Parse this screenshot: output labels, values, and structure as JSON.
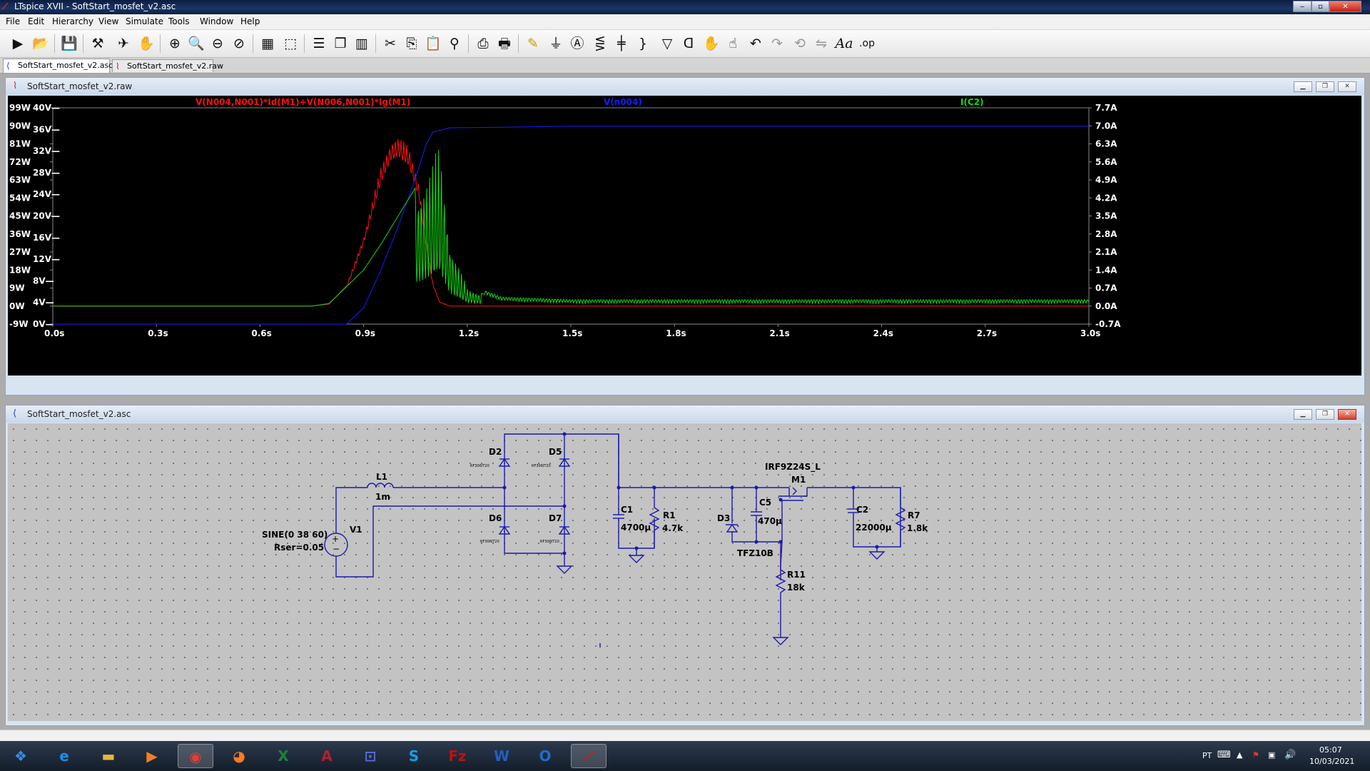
{
  "window": {
    "title": "LTspice XVII - SoftStart_mosfet_v2.asc",
    "minimize": "‒",
    "restore": "▫",
    "close": "✕"
  },
  "menu": [
    "File",
    "Edit",
    "Hierarchy",
    "View",
    "Simulate",
    "Tools",
    "Window",
    "Help"
  ],
  "toolbar_icons": [
    "run-icon",
    "open-icon",
    "save-icon",
    "control-panel-icon",
    "halt-icon",
    "pan-icon",
    "zoom-in-icon",
    "zoom-area-icon",
    "zoom-out-icon",
    "zoom-fit-icon",
    "autorange-icon",
    "zoom-cancel-icon",
    "tile-horizontal-icon",
    "cascade-icon",
    "tile-vertical-icon",
    "cut-icon",
    "copy-icon",
    "paste-icon",
    "find-icon",
    "print-icon",
    "print-preview-icon",
    "draw-wire-icon",
    "ground-icon",
    "label-net-icon",
    "resistor-icon",
    "capacitor-icon",
    "inductor-icon",
    "diode-icon",
    "component-icon",
    "move-icon",
    "drag-icon",
    "undo-icon",
    "redo-icon",
    "rotate-icon",
    "mirror-icon",
    "text-icon",
    "spice-directive-icon"
  ],
  "tabs": [
    {
      "label": "SoftStart_mosfet_v2.asc",
      "icon": "schematic-icon",
      "active": true
    },
    {
      "label": "SoftStart_mosfet_v2.raw",
      "icon": "waveform-icon",
      "active": false
    }
  ],
  "plot_window": {
    "title": "SoftStart_mosfet_v2.raw"
  },
  "schematic_window": {
    "title": "SoftStart_mosfet_v2.asc"
  },
  "chart_data": {
    "type": "line",
    "xlabel": "",
    "x_ticks": [
      "0.0s",
      "0.3s",
      "0.6s",
      "0.9s",
      "1.2s",
      "1.5s",
      "1.8s",
      "2.1s",
      "2.4s",
      "2.7s",
      "3.0s"
    ],
    "xlim": [
      0,
      3.0
    ],
    "left_axis_1": {
      "unit": "W",
      "ticks": [
        "99W",
        "90W",
        "81W",
        "72W",
        "63W",
        "54W",
        "45W",
        "36W",
        "27W",
        "18W",
        "9W",
        "0W",
        "-9W"
      ],
      "range": [
        -9,
        99
      ]
    },
    "left_axis_2": {
      "unit": "V",
      "ticks": [
        "40V",
        "36V",
        "32V",
        "28V",
        "24V",
        "20V",
        "16V",
        "12V",
        "8V",
        "4V",
        "0V"
      ],
      "range": [
        0,
        40
      ]
    },
    "right_axis": {
      "unit": "A",
      "ticks": [
        "7.7A",
        "7.0A",
        "6.3A",
        "5.6A",
        "4.9A",
        "4.2A",
        "3.5A",
        "2.8A",
        "2.1A",
        "1.4A",
        "0.7A",
        "0.0A",
        "-0.7A"
      ],
      "range": [
        -0.7,
        7.7
      ]
    },
    "grid": false,
    "series": [
      {
        "name": "V(N004,N001)*Id(M1)+V(N006,N001)*Ig(M1)",
        "color": "#ff1010",
        "axis": "W",
        "points": [
          [
            0,
            0
          ],
          [
            0.75,
            0
          ],
          [
            0.8,
            1
          ],
          [
            0.85,
            10
          ],
          [
            0.9,
            35
          ],
          [
            0.95,
            70
          ],
          [
            0.98,
            83
          ],
          [
            1.0,
            85
          ],
          [
            1.03,
            80
          ],
          [
            1.06,
            62
          ],
          [
            1.08,
            35
          ],
          [
            1.1,
            12
          ],
          [
            1.12,
            2
          ],
          [
            1.15,
            0
          ],
          [
            1.5,
            0
          ],
          [
            3.0,
            0
          ]
        ]
      },
      {
        "name": "V(n004)",
        "color": "#1a1aff",
        "axis": "V",
        "points": [
          [
            0,
            0
          ],
          [
            0.85,
            0
          ],
          [
            0.9,
            3
          ],
          [
            0.95,
            10
          ],
          [
            1.0,
            18
          ],
          [
            1.05,
            27
          ],
          [
            1.08,
            33
          ],
          [
            1.1,
            35.5
          ],
          [
            1.15,
            36.3
          ],
          [
            1.3,
            36.4
          ],
          [
            1.5,
            36.6
          ],
          [
            3.0,
            36.6
          ]
        ]
      },
      {
        "name": "I(C2)",
        "color": "#10dd10",
        "axis": "A",
        "points": [
          [
            0,
            0
          ],
          [
            0.75,
            0
          ],
          [
            0.8,
            0.1
          ],
          [
            0.9,
            1.4
          ],
          [
            0.95,
            2.4
          ],
          [
            1.0,
            3.5
          ],
          [
            1.05,
            4.6
          ],
          [
            1.1,
            5.6
          ],
          [
            1.12,
            6.7
          ],
          [
            1.15,
            2.5
          ],
          [
            1.2,
            0.7
          ],
          [
            1.3,
            0.2
          ],
          [
            1.5,
            0.1
          ],
          [
            3.0,
            0.1
          ]
        ],
        "ripple": 0.15
      }
    ]
  },
  "schematic": {
    "v1": {
      "name": "V1",
      "value": "SINE(0 38 60)",
      "rser": "Rser=0.05"
    },
    "l1": {
      "name": "L1",
      "value": "1m"
    },
    "d2": {
      "name": "D2",
      "part": "RF306IT20"
    },
    "d5": {
      "name": "D5",
      "part": "RF306IT20"
    },
    "d6": {
      "name": "D6",
      "part": "RF306IT20"
    },
    "d7": {
      "name": "D7",
      "part": "RF306IT20"
    },
    "c1": {
      "name": "C1",
      "value": "4700µ"
    },
    "r1": {
      "name": "R1",
      "value": "4.7k"
    },
    "d3": {
      "name": "D3",
      "part": "TFZ10B"
    },
    "c5": {
      "name": "C5",
      "value": "470µ"
    },
    "m1": {
      "name": "M1",
      "part": "IRF9Z24S_L"
    },
    "r11": {
      "name": "R11",
      "value": "18k"
    },
    "c2": {
      "name": "C2",
      "value": "22000µ"
    },
    "r7": {
      "name": "R7",
      "value": "1.8k"
    }
  },
  "taskbar": {
    "apps": [
      {
        "name": "start-button",
        "glyph": "❖",
        "color": "#3c8de0"
      },
      {
        "name": "internet-explorer-icon",
        "glyph": "e",
        "color": "#1e8fe0"
      },
      {
        "name": "file-explorer-icon",
        "glyph": "▬",
        "color": "#e6b640"
      },
      {
        "name": "media-player-icon",
        "glyph": "▶",
        "color": "#f08020"
      },
      {
        "name": "chrome-icon",
        "glyph": "◉",
        "color": "#e04030"
      },
      {
        "name": "firefox-icon",
        "glyph": "◕",
        "color": "#ff7a20"
      },
      {
        "name": "excel-icon",
        "glyph": "X",
        "color": "#1e8040"
      },
      {
        "name": "access-icon",
        "glyph": "A",
        "color": "#b02030"
      },
      {
        "name": "web-app-icon",
        "glyph": "⊡",
        "color": "#5a6ad0"
      },
      {
        "name": "skype-icon",
        "glyph": "S",
        "color": "#10a0e8"
      },
      {
        "name": "filezilla-icon",
        "glyph": "Fz",
        "color": "#c01010"
      },
      {
        "name": "word-icon",
        "glyph": "W",
        "color": "#2060c0"
      },
      {
        "name": "outlook-icon",
        "glyph": "O",
        "color": "#1a6fd0"
      },
      {
        "name": "ltspice-icon",
        "glyph": "⟋",
        "color": "#c02020"
      }
    ],
    "language": "PT",
    "time": "05:07",
    "date": "10/03/2021"
  }
}
